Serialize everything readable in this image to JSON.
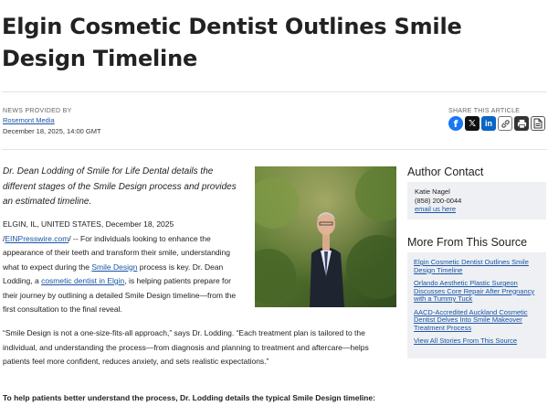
{
  "article": {
    "title": "Elgin Cosmetic Dentist Outlines Smile Design Timeline",
    "news_provided_by_label": "NEWS PROVIDED BY",
    "provider": "Rosemont Media",
    "date": "December 18, 2025, 14:00 GMT",
    "share_label": "SHARE THIS ARTICLE",
    "lead": "Dr. Dean Lodding of Smile for Life Dental details the different stages of the Smile Design process and provides an estimated timeline.",
    "p1": {
      "dateline": "ELGIN, IL, UNITED STATES, December 18, 2025",
      "slash": "/",
      "einpresswire": "EINPresswire.com",
      "t1": "/ -- For individuals looking to enhance the appearance of their teeth and transform their smile, understanding what to expect during the ",
      "smile_design_link": "Smile Design",
      "t2": " process is key. Dr. Dean Lodding, a ",
      "cosmetic_link": "cosmetic dentist in Elgin",
      "t3": ", is helping patients prepare for their journey by outlining a detailed Smile Design timeline—from the first consultation to the final reveal."
    },
    "p2": "“Smile Design is not a one-size-fits-all approach,” says Dr. Lodding. “Each treatment plan is tailored to the individual, and understanding the process—from diagnosis and planning to treatment and aftercare—helps patients feel more confident, reduces anxiety, and sets realistic expectations.”",
    "p3_partial": "To help patients better understand the process, Dr. Lodding details the typical Smile Design timeline:"
  },
  "share_buttons": [
    {
      "name": "facebook",
      "icon": "facebook-icon",
      "color": "#1877f2"
    },
    {
      "name": "x",
      "icon": "x-icon",
      "color": "#111111"
    },
    {
      "name": "linkedin",
      "icon": "linkedin-icon",
      "color": "#0a66c2"
    },
    {
      "name": "copy-link",
      "icon": "link-icon",
      "color": "#555555"
    },
    {
      "name": "print",
      "icon": "print-icon",
      "color": "#333333"
    },
    {
      "name": "pdf",
      "icon": "pdf-icon",
      "color": "#333333"
    }
  ],
  "sidebar": {
    "author_heading": "Author Contact",
    "contact_name": "Katie Nagel",
    "contact_phone": "(858) 200-0044",
    "contact_email": "email us here",
    "more_heading": "More From This Source",
    "stories": [
      "Elgin Cosmetic Dentist Outlines Smile Design Timeline",
      "Orlando Aesthetic Plastic Surgeon Discusses Core Repair After Pregnancy with a Tummy Tuck",
      "AACD-Accredited Auckland Cosmetic Dentist Delves Into Smile Makeover Treatment Process",
      "View All Stories From This Source"
    ]
  }
}
